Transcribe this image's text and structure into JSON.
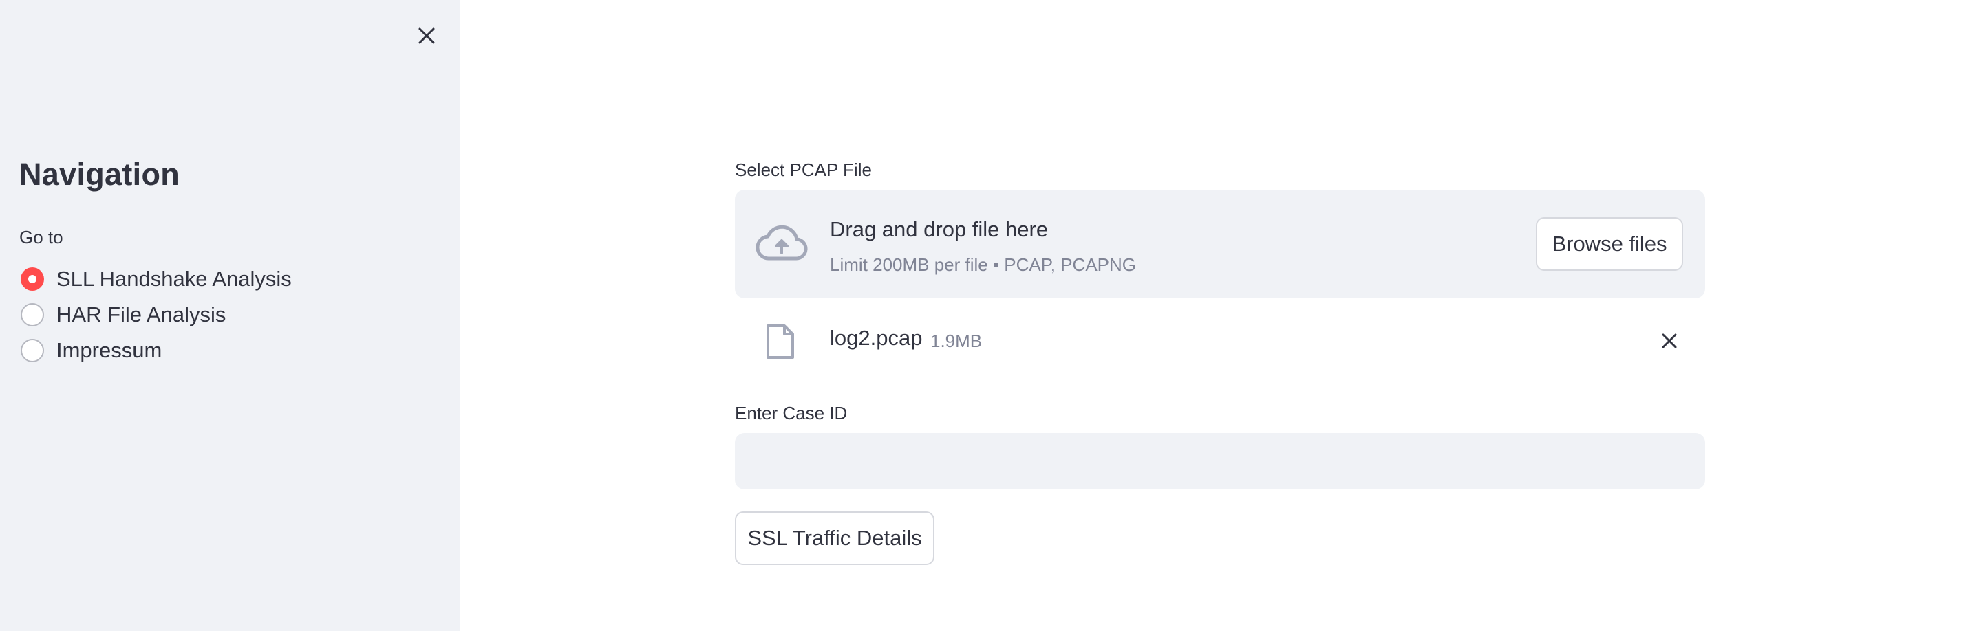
{
  "sidebar": {
    "title": "Navigation",
    "goto_label": "Go to",
    "options": [
      {
        "label": "SLL Handshake Analysis",
        "selected": true
      },
      {
        "label": "HAR File Analysis",
        "selected": false
      },
      {
        "label": "Impressum",
        "selected": false
      }
    ],
    "close_icon": "close-icon"
  },
  "uploader": {
    "label": "Select PCAP File",
    "drop_text": "Drag and drop file here",
    "limit_text": "Limit 200MB per file • PCAP, PCAPNG",
    "browse_label": "Browse files",
    "icon": "cloud-upload-icon"
  },
  "uploaded_file": {
    "name": "log2.pcap",
    "size": "1.9MB",
    "icon": "file-icon",
    "remove_icon": "close-icon"
  },
  "case_id": {
    "label": "Enter Case ID",
    "value": "",
    "placeholder": ""
  },
  "action_button": {
    "label": "SSL Traffic Details"
  },
  "colors": {
    "accent": "#ff4b4b",
    "sidebar_bg": "#f0f2f6",
    "text": "#31333f",
    "muted": "#808495",
    "icon": "#a3a8b8"
  }
}
